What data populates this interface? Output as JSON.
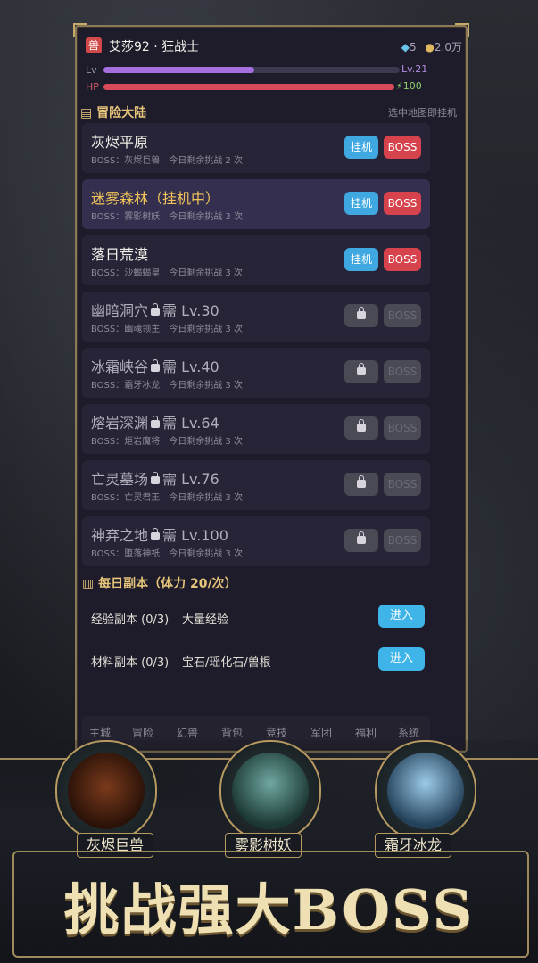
{
  "player": {
    "job_icon": "兽",
    "name": "艾莎92 · 狂战士",
    "gems": "5",
    "gold": "2.0万",
    "lv_label": "Lv",
    "level": "Lv.21",
    "lv_progress": 0.51,
    "hp_label": "HP",
    "energy": "100"
  },
  "adventure": {
    "title": "冒险大陆",
    "hint": "选中地图即挂机",
    "maps": [
      {
        "name": "灰烬平原",
        "sub": "BOSS：灰烬巨兽　今日剩余挑战 2 次",
        "locked": false,
        "active": false
      },
      {
        "name": "迷雾森林（挂机中）",
        "sub": "BOSS：雾影树妖　今日剩余挑战 3 次",
        "locked": false,
        "active": true
      },
      {
        "name": "落日荒漠",
        "sub": "BOSS：沙蝎蝎皇　今日剩余挑战 3 次",
        "locked": false,
        "active": false
      },
      {
        "name": "幽暗洞穴",
        "req": "需 Lv.30",
        "sub": "BOSS：幽魂领主　今日剩余挑战 3 次",
        "locked": true
      },
      {
        "name": "冰霜峡谷",
        "req": "需 Lv.40",
        "sub": "BOSS：霜牙冰龙　今日剩余挑战 3 次",
        "locked": true
      },
      {
        "name": "熔岩深渊",
        "req": "需 Lv.64",
        "sub": "BOSS：炬岩魔将　今日剩余挑战 3 次",
        "locked": true
      },
      {
        "name": "亡灵墓场",
        "req": "需 Lv.76",
        "sub": "BOSS：亡灵君王　今日剩余挑战 3 次",
        "locked": true
      },
      {
        "name": "神弃之地",
        "req": "需 Lv.100",
        "sub": "BOSS：堕落神祇　今日剩余挑战 3 次",
        "locked": true
      }
    ],
    "idle_label": "挂机",
    "boss_label": "BOSS"
  },
  "daily": {
    "title": "每日副本（体力 20/次）",
    "rows": [
      {
        "name": "经验副本 (0/3)",
        "desc": "大量经验",
        "enter": "进入"
      },
      {
        "name": "材料副本 (0/3)",
        "desc": "宝石/瑶化石/兽根",
        "enter": "进入"
      }
    ]
  },
  "tabs": [
    "主城",
    "冒险",
    "幻兽",
    "背包",
    "竞技",
    "军团",
    "福利",
    "系统"
  ],
  "bosses": [
    {
      "name": "灰烬巨兽"
    },
    {
      "name": "雾影树妖"
    },
    {
      "name": "霜牙冰龙"
    }
  ],
  "banner_title": "挑战强大BOSS",
  "colors": {
    "accent_gold": "#e6c47a",
    "idle_blue": "#3fa8e0",
    "boss_red": "#d7434d"
  }
}
